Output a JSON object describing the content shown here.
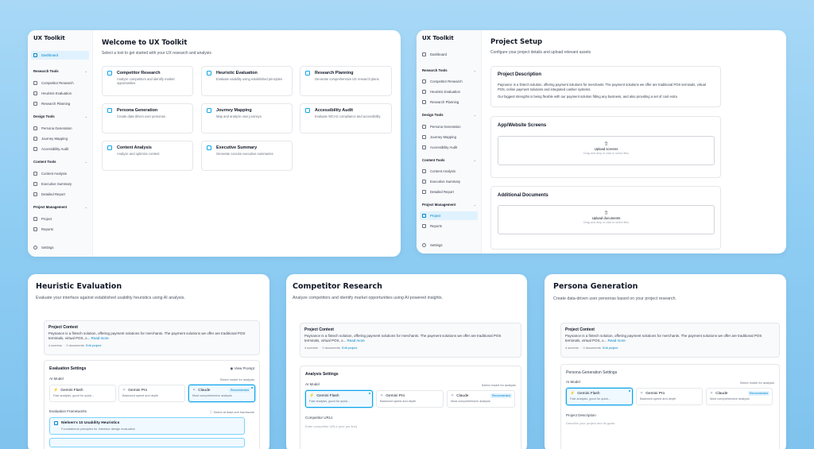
{
  "panel1": {
    "brand": "UX Toolkit",
    "nav": {
      "dashboard": "Dashboard",
      "groups": [
        {
          "label": "Research Tools",
          "items": [
            "Competitor Research",
            "Heuristic Evaluation",
            "Research Planning"
          ]
        },
        {
          "label": "Design Tools",
          "items": [
            "Persona Generation",
            "Journey Mapping",
            "Accessibility Audit"
          ]
        },
        {
          "label": "Content Tools",
          "items": [
            "Content Analysis",
            "Executive Summary",
            "Detailed Report"
          ]
        },
        {
          "label": "Project Management",
          "items": [
            "Project",
            "Reports"
          ]
        }
      ],
      "settings": "Settings"
    },
    "title": "Welcome to UX Toolkit",
    "subtitle": "Select a tool to get started with your UX research and analysis",
    "cards": [
      {
        "title": "Competitor Research",
        "desc": "Analyze competitors and identify market opportunities"
      },
      {
        "title": "Heuristic Evaluation",
        "desc": "Evaluate usability using established principles"
      },
      {
        "title": "Research Planning",
        "desc": "Generate comprehensive UX research plans"
      },
      {
        "title": "Persona Generation",
        "desc": "Create data-driven user personas"
      },
      {
        "title": "Journey Mapping",
        "desc": "Map and analyze user journeys"
      },
      {
        "title": "Accessibility Audit",
        "desc": "Evaluate WCAG compliance and accessibility"
      },
      {
        "title": "Content Analysis",
        "desc": "Analyze and optimize content"
      },
      {
        "title": "Executive Summary",
        "desc": "Generate concise executive summaries"
      }
    ]
  },
  "panel2": {
    "brand": "UX Toolkit",
    "title": "Project Setup",
    "subtitle": "Configure your project details and upload relevant assets",
    "description_title": "Project Description",
    "description_text1": "Paynance is a fintech solution, offering payment solutions for merchants. The payment solutions we offer are traditional POS terminals, virtual POS, online payment solutions and integrated cashier systems.",
    "description_text2": "Our biggest strengths is being flexible with our payment solution fitting any business, and also providing a set of cool extra",
    "screens_title": "App/Website Screens",
    "docs_title": "Additional Documents",
    "upload_screens": "Upload screens",
    "upload_docs": "Upload documents",
    "upload_hint": "Drag and drop or click to select files"
  },
  "context": {
    "title": "Project Context",
    "text": "Paynance is a fintech solution, offering payment solutions for merchants. The payment solutions we offer are traditional POS terminals, virtual POS, online payment solutions and integrated cashier systems, o...",
    "text_short": "Paynance is a fintech solution, offering payment solutions for merchants. The payment solutions we offer are traditional POS terminals, virtual POS, o...",
    "read_more": "Read more",
    "screens": "4 screens",
    "docs": "0 documents",
    "edit": "Edit project"
  },
  "models": {
    "ai_model_label": "AI Model",
    "select_hint": "Select model for analysis",
    "gemini_flash": "Gemini Flash",
    "gemini_flash_desc": "Fast analysis, good for quick...",
    "gemini_pro": "Gemini Pro",
    "gemini_pro_desc": "Balanced speed and depth",
    "claude": "Claude",
    "claude_desc": "Most comprehensive analysis",
    "recommended": "Recommended"
  },
  "panel3": {
    "title": "Heuristic Evaluation",
    "subtitle": "Evaluate your interface against established usability heuristics using AI analysis.",
    "settings_title": "Evaluation Settings",
    "view_prompt": "View Prompt",
    "frameworks_label": "Evaluation Frameworks",
    "frameworks_hint": "Select at least one framework",
    "framework_name": "Nielsen's 10 Usability Heuristics",
    "framework_desc": "Foundational principles for interface design evaluation"
  },
  "panel4": {
    "title": "Competitor Research",
    "subtitle": "Analyze competitors and identify market opportunities using AI-powered insights.",
    "settings_title": "Analysis Settings",
    "urls_label": "Competitor URLs",
    "urls_placeholder": "Enter competitor URLs (one per line)"
  },
  "panel5": {
    "title": "Persona Generation",
    "subtitle": "Create data-driven user personas based on your project research.",
    "settings_title": "Persona Generation Settings",
    "desc_label": "Project Description",
    "desc_placeholder": "Describe your project and its goals"
  }
}
